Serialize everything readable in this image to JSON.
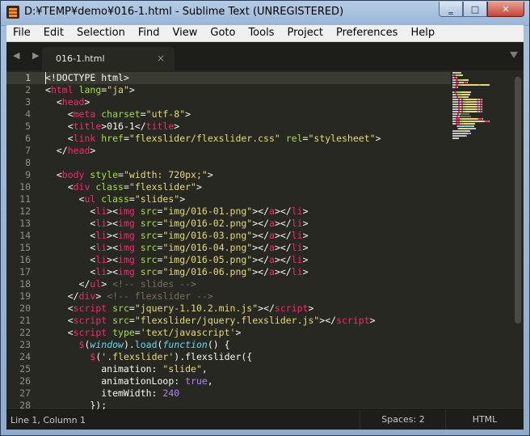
{
  "window": {
    "title": "D:¥TEMP¥demo¥016-1.html - Sublime Text (UNREGISTERED)",
    "buttons": {
      "minimize": "‗",
      "maximize": "□",
      "close": "✕"
    }
  },
  "menu": [
    "File",
    "Edit",
    "Selection",
    "Find",
    "View",
    "Goto",
    "Tools",
    "Project",
    "Preferences",
    "Help"
  ],
  "tabs": {
    "nav_arrows": "◀ ▶",
    "active_tab": "016-1.html",
    "close_glyph": "×"
  },
  "editor": {
    "line_numbers": [
      "1",
      "2",
      "3",
      "4",
      "5",
      "6",
      "7",
      "8",
      "9",
      "10",
      "11",
      "12",
      "13",
      "14",
      "15",
      "16",
      "17",
      "18",
      "19",
      "20",
      "21",
      "22",
      "23",
      "24",
      "25",
      "26",
      "27",
      "28"
    ],
    "active_line": 1,
    "lines": [
      [
        [
          "plain",
          "<!DOCTYPE html>"
        ]
      ],
      [
        [
          "plain",
          "<"
        ],
        [
          "tag",
          "html"
        ],
        [
          "attr",
          " lang"
        ],
        [
          "plain",
          "="
        ],
        [
          "str",
          "\"ja\""
        ],
        [
          "plain",
          ">"
        ]
      ],
      [
        [
          "plain",
          "  <"
        ],
        [
          "tag",
          "head"
        ],
        [
          "plain",
          ">"
        ]
      ],
      [
        [
          "plain",
          "    <"
        ],
        [
          "tag",
          "meta"
        ],
        [
          "attr",
          " charset"
        ],
        [
          "plain",
          "="
        ],
        [
          "str",
          "\"utf-8\""
        ],
        [
          "plain",
          ">"
        ]
      ],
      [
        [
          "plain",
          "    <"
        ],
        [
          "tag",
          "title"
        ],
        [
          "plain",
          ">016-1</"
        ],
        [
          "tag",
          "title"
        ],
        [
          "plain",
          ">"
        ]
      ],
      [
        [
          "plain",
          "    <"
        ],
        [
          "tag",
          "link"
        ],
        [
          "attr",
          " href"
        ],
        [
          "plain",
          "="
        ],
        [
          "str",
          "\"flexslider/flexslider.css\""
        ],
        [
          "attr",
          " rel"
        ],
        [
          "plain",
          "="
        ],
        [
          "str",
          "\"stylesheet\""
        ],
        [
          "plain",
          ">"
        ]
      ],
      [
        [
          "plain",
          "  </"
        ],
        [
          "tag",
          "head"
        ],
        [
          "plain",
          ">"
        ]
      ],
      [
        [
          "plain",
          ""
        ]
      ],
      [
        [
          "plain",
          "  <"
        ],
        [
          "tag",
          "body"
        ],
        [
          "attr",
          " style"
        ],
        [
          "plain",
          "="
        ],
        [
          "str",
          "\"width: 720px;\""
        ],
        [
          "plain",
          ">"
        ]
      ],
      [
        [
          "plain",
          "    <"
        ],
        [
          "tag",
          "div"
        ],
        [
          "attr",
          " class"
        ],
        [
          "plain",
          "="
        ],
        [
          "str",
          "\"flexslider\""
        ],
        [
          "plain",
          ">"
        ]
      ],
      [
        [
          "plain",
          "      <"
        ],
        [
          "tag",
          "ul"
        ],
        [
          "attr",
          " class"
        ],
        [
          "plain",
          "="
        ],
        [
          "str",
          "\"slides\""
        ],
        [
          "plain",
          ">"
        ]
      ],
      [
        [
          "plain",
          "        <"
        ],
        [
          "tag",
          "li"
        ],
        [
          "plain",
          "><"
        ],
        [
          "tag",
          "img"
        ],
        [
          "attr",
          " src"
        ],
        [
          "plain",
          "="
        ],
        [
          "str",
          "\"img/016-01.png\""
        ],
        [
          "plain",
          "></"
        ],
        [
          "tag",
          "a"
        ],
        [
          "plain",
          "></"
        ],
        [
          "tag",
          "li"
        ],
        [
          "plain",
          ">"
        ]
      ],
      [
        [
          "plain",
          "        <"
        ],
        [
          "tag",
          "li"
        ],
        [
          "plain",
          "><"
        ],
        [
          "tag",
          "img"
        ],
        [
          "attr",
          " src"
        ],
        [
          "plain",
          "="
        ],
        [
          "str",
          "\"img/016-02.png\""
        ],
        [
          "plain",
          "></"
        ],
        [
          "tag",
          "a"
        ],
        [
          "plain",
          "></"
        ],
        [
          "tag",
          "li"
        ],
        [
          "plain",
          ">"
        ]
      ],
      [
        [
          "plain",
          "        <"
        ],
        [
          "tag",
          "li"
        ],
        [
          "plain",
          "><"
        ],
        [
          "tag",
          "img"
        ],
        [
          "attr",
          " src"
        ],
        [
          "plain",
          "="
        ],
        [
          "str",
          "\"img/016-03.png\""
        ],
        [
          "plain",
          "></"
        ],
        [
          "tag",
          "a"
        ],
        [
          "plain",
          "></"
        ],
        [
          "tag",
          "li"
        ],
        [
          "plain",
          ">"
        ]
      ],
      [
        [
          "plain",
          "        <"
        ],
        [
          "tag",
          "li"
        ],
        [
          "plain",
          "><"
        ],
        [
          "tag",
          "img"
        ],
        [
          "attr",
          " src"
        ],
        [
          "plain",
          "="
        ],
        [
          "str",
          "\"img/016-04.png\""
        ],
        [
          "plain",
          "></"
        ],
        [
          "tag",
          "a"
        ],
        [
          "plain",
          "></"
        ],
        [
          "tag",
          "li"
        ],
        [
          "plain",
          ">"
        ]
      ],
      [
        [
          "plain",
          "        <"
        ],
        [
          "tag",
          "li"
        ],
        [
          "plain",
          "><"
        ],
        [
          "tag",
          "img"
        ],
        [
          "attr",
          " src"
        ],
        [
          "plain",
          "="
        ],
        [
          "str",
          "\"img/016-05.png\""
        ],
        [
          "plain",
          "></"
        ],
        [
          "tag",
          "a"
        ],
        [
          "plain",
          "></"
        ],
        [
          "tag",
          "li"
        ],
        [
          "plain",
          ">"
        ]
      ],
      [
        [
          "plain",
          "        <"
        ],
        [
          "tag",
          "li"
        ],
        [
          "plain",
          "><"
        ],
        [
          "tag",
          "img"
        ],
        [
          "attr",
          " src"
        ],
        [
          "plain",
          "="
        ],
        [
          "str",
          "\"img/016-06.png\""
        ],
        [
          "plain",
          "></"
        ],
        [
          "tag",
          "a"
        ],
        [
          "plain",
          "></"
        ],
        [
          "tag",
          "li"
        ],
        [
          "plain",
          ">"
        ]
      ],
      [
        [
          "plain",
          "      </"
        ],
        [
          "tag",
          "ul"
        ],
        [
          "plain",
          "> "
        ],
        [
          "cmt",
          "<!-- slides -->"
        ]
      ],
      [
        [
          "plain",
          "    </"
        ],
        [
          "tag",
          "div"
        ],
        [
          "plain",
          "> "
        ],
        [
          "cmt",
          "<!-- flexslider -->"
        ]
      ],
      [
        [
          "plain",
          "    <"
        ],
        [
          "tag",
          "script"
        ],
        [
          "attr",
          " src"
        ],
        [
          "plain",
          "="
        ],
        [
          "str",
          "\"jquery-1.10.2.min.js\""
        ],
        [
          "plain",
          "></"
        ],
        [
          "tag",
          "script"
        ],
        [
          "plain",
          ">"
        ]
      ],
      [
        [
          "plain",
          "    <"
        ],
        [
          "tag",
          "script"
        ],
        [
          "attr",
          " src"
        ],
        [
          "plain",
          "="
        ],
        [
          "str",
          "\"flexslider/jquery.flexslider.js\""
        ],
        [
          "plain",
          "></"
        ],
        [
          "tag",
          "script"
        ],
        [
          "plain",
          ">"
        ]
      ],
      [
        [
          "plain",
          "    <"
        ],
        [
          "tag",
          "script"
        ],
        [
          "attr",
          " type"
        ],
        [
          "plain",
          "="
        ],
        [
          "str",
          "'text/javascript'"
        ],
        [
          "plain",
          ">"
        ]
      ],
      [
        [
          "plain",
          "      "
        ],
        [
          "pink",
          "$"
        ],
        [
          "plain",
          "("
        ],
        [
          "fn",
          "window"
        ],
        [
          "plain",
          ")."
        ],
        [
          "call",
          "load"
        ],
        [
          "plain",
          "("
        ],
        [
          "fn",
          "function"
        ],
        [
          "plain",
          "() {"
        ]
      ],
      [
        [
          "plain",
          "        "
        ],
        [
          "pink",
          "$"
        ],
        [
          "plain",
          "("
        ],
        [
          "str",
          "'.flexslider'"
        ],
        [
          "plain",
          ").flexslider({"
        ]
      ],
      [
        [
          "plain",
          "          animation: "
        ],
        [
          "str",
          "\"slide\""
        ],
        [
          "plain",
          ","
        ]
      ],
      [
        [
          "plain",
          "          animationLoop: "
        ],
        [
          "kw",
          "true"
        ],
        [
          "plain",
          ","
        ]
      ],
      [
        [
          "plain",
          "          itemWidth: "
        ],
        [
          "kw",
          "240"
        ]
      ],
      [
        [
          "plain",
          "        });"
        ]
      ]
    ]
  },
  "status": {
    "position": "Line 1, Column 1",
    "indentation": "Spaces: 2",
    "syntax": "HTML"
  },
  "colors": {
    "background": "#272822",
    "tag": "#f92672",
    "attribute": "#a6e22e",
    "string": "#e6db74",
    "comment": "#75715e",
    "function": "#66d9ef",
    "number": "#ae81ff"
  }
}
